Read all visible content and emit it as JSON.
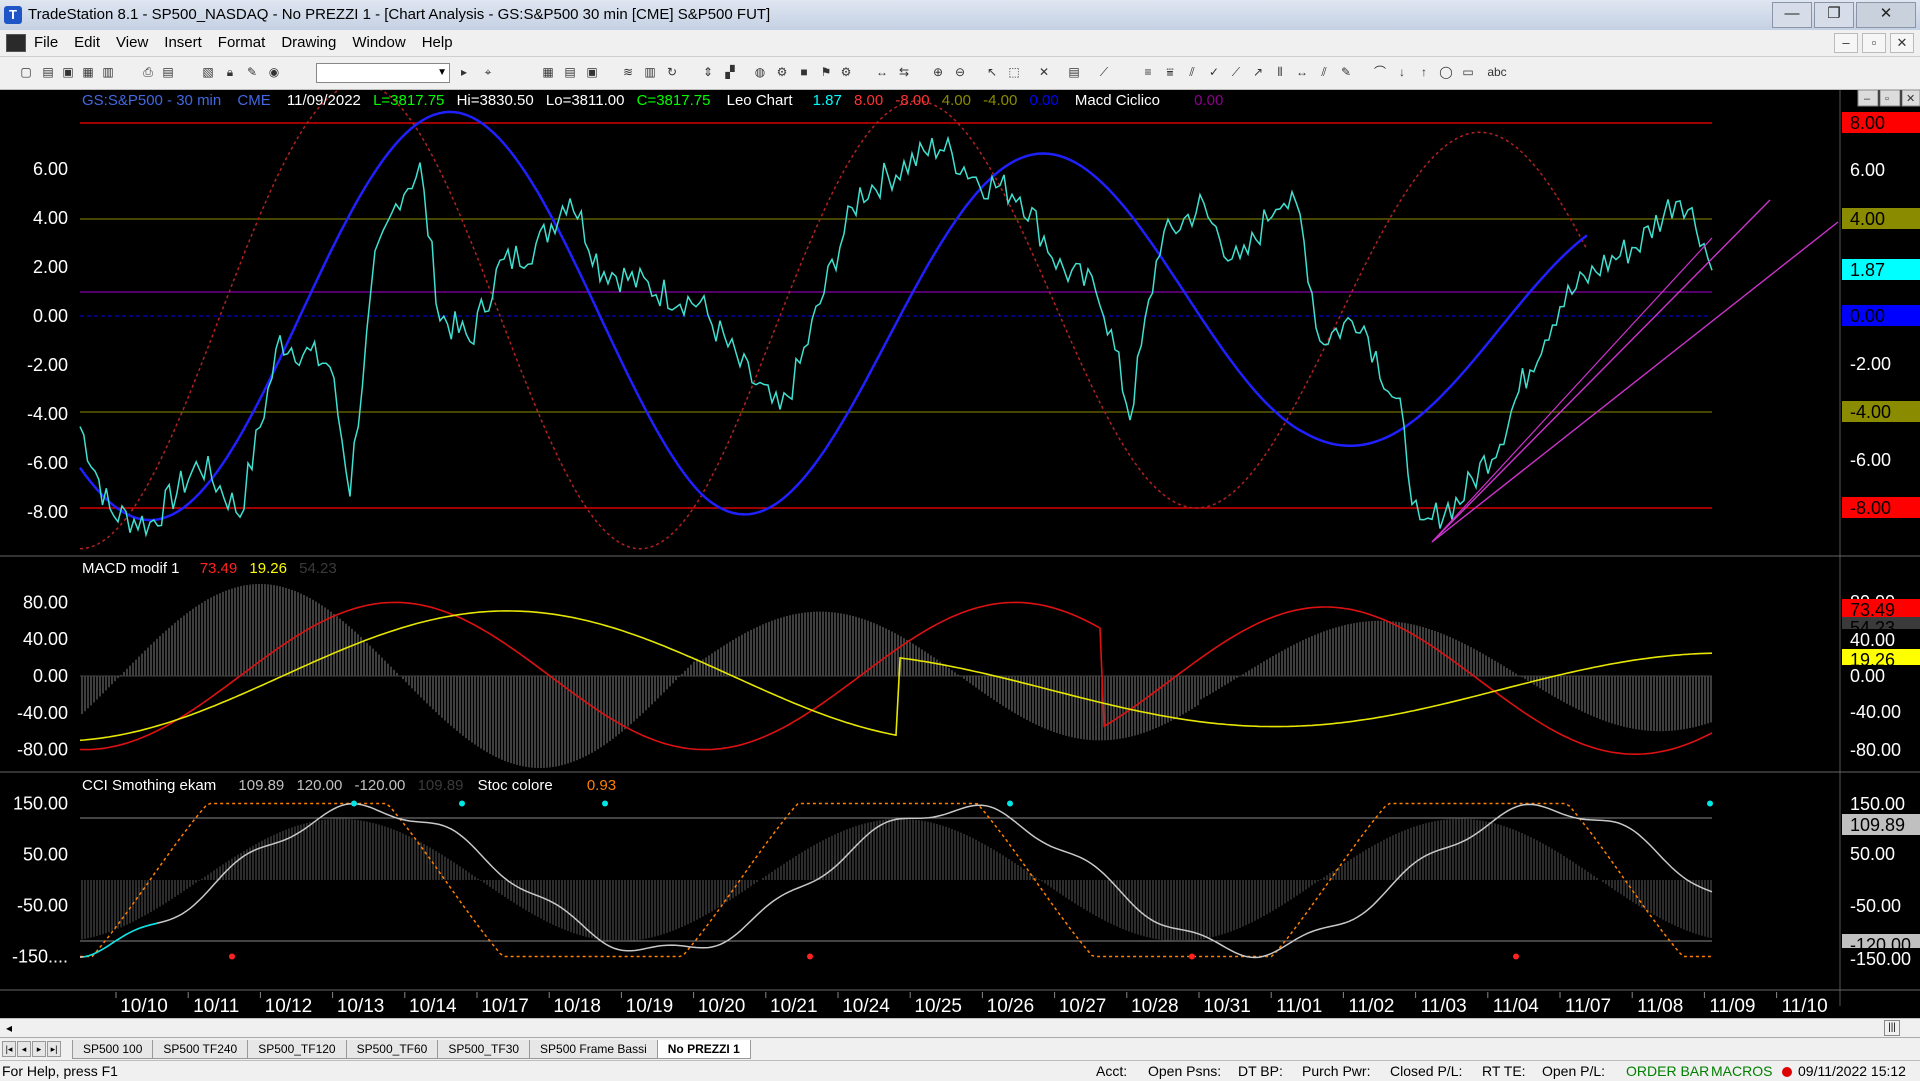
{
  "window": {
    "title": "TradeStation 8.1 - SP500_NASDAQ - No PREZZI 1 - [Chart Analysis - GS:S&P500  30 min  [CME] S&P500 FUT]",
    "app_icon": "tradestation-icon",
    "controls": {
      "minimize": "—",
      "maximize": "❐",
      "close": "✕"
    }
  },
  "menubar": {
    "items": [
      "File",
      "Edit",
      "View",
      "Insert",
      "Format",
      "Drawing",
      "Window",
      "Help"
    ],
    "mdi_controls": {
      "minimize": "–",
      "restore": "▫",
      "close": "✕"
    }
  },
  "toolbar": {
    "combo_value": "",
    "icons": [
      "new-icon",
      "open-icon",
      "save-icon",
      "save-all-icon",
      "print-preview-icon",
      "print-icon",
      "format-icon",
      "format-symbol-icon",
      "lock-icon",
      "wand-icon",
      "chart-icon",
      "crosshair-icon",
      "zoom-in-icon",
      "zoom-out-icon",
      "pointer-icon",
      "trendline-icon",
      "text-icon",
      "ellipse-icon",
      "rectangle-icon"
    ],
    "text_tool": "abc"
  },
  "chart": {
    "header": {
      "symbol": "GS:S&P500 - 30 min",
      "exchange": "CME",
      "date": "11/09/2022",
      "last": "L=3817.75",
      "high": "Hi=3830.50",
      "low": "Lo=3811.00",
      "close": "C=3817.75",
      "study1_name": "Leo Chart",
      "study1_v1": "1.87",
      "study1_v2": "8.00",
      "study1_v3": "-8.00",
      "study1_v4": "4.00",
      "study1_v5": "-4.00",
      "study1_v6": "0.00",
      "study2_name": "Macd Ciclico",
      "study2_v1": "0.00"
    },
    "panel1": {
      "y_labels": [
        "6.00",
        "4.00",
        "2.00",
        "0.00",
        "-2.00",
        "-4.00",
        "-6.00",
        "-8.00"
      ],
      "right_badges": [
        {
          "text": "8.00",
          "bg": "#ff0000",
          "fg": "#000000"
        },
        {
          "text": "6.00",
          "bg": "#000000",
          "fg": "#ffffff"
        },
        {
          "text": "4.00",
          "bg": "#8b8b00",
          "fg": "#000000"
        },
        {
          "text": "1.87",
          "bg": "#00ffff",
          "fg": "#000000"
        },
        {
          "text": "0.00",
          "bg": "#0000ff",
          "fg": "#000000"
        },
        {
          "text": "-2.00",
          "bg": "#000000",
          "fg": "#ffffff"
        },
        {
          "text": "-4.00",
          "bg": "#8b8b00",
          "fg": "#000000"
        },
        {
          "text": "-6.00",
          "bg": "#000000",
          "fg": "#ffffff"
        },
        {
          "text": "-8.00",
          "bg": "#ff0000",
          "fg": "#000000"
        }
      ]
    },
    "panel2": {
      "name": "MACD modif 1",
      "v1": "73.49",
      "v2": "19.26",
      "v3": "54.23",
      "y_labels": [
        "80.00",
        "40.00",
        "0.00",
        "-40.00",
        "-80.00"
      ],
      "right_badges": [
        {
          "text": "80.00",
          "bg": "#000000",
          "fg": "#ffffff"
        },
        {
          "text": "73.49",
          "bg": "#ff0000",
          "fg": "#000000"
        },
        {
          "text": "54.23",
          "bg": "#3a3a3a",
          "fg": "#000000"
        },
        {
          "text": "40.00",
          "bg": "#000000",
          "fg": "#ffffff"
        },
        {
          "text": "19.26",
          "bg": "#ffff00",
          "fg": "#000000"
        },
        {
          "text": "0.00",
          "bg": "#000000",
          "fg": "#ffffff"
        },
        {
          "text": "-40.00",
          "bg": "#000000",
          "fg": "#ffffff"
        },
        {
          "text": "-80.00",
          "bg": "#000000",
          "fg": "#ffffff"
        }
      ]
    },
    "panel3": {
      "name": "CCI Smothing ekam",
      "v1": "109.89",
      "v2": "120.00",
      "v3": "-120.00",
      "v4": "109.89",
      "stoc_name": "Stoc colore",
      "stoc_v": "0.93",
      "y_labels": [
        "150.00",
        "50.00",
        "-50.00",
        "-150...."
      ],
      "right_badges": [
        {
          "text": "150.00",
          "bg": "#000000",
          "fg": "#ffffff"
        },
        {
          "text": "109.89",
          "bg": "#c0c0c0",
          "fg": "#000000"
        },
        {
          "text": "50.00",
          "bg": "#000000",
          "fg": "#ffffff"
        },
        {
          "text": "-50.00",
          "bg": "#000000",
          "fg": "#ffffff"
        },
        {
          "text": "-120.00",
          "bg": "#c0c0c0",
          "fg": "#000000"
        },
        {
          "text": "-150.00",
          "bg": "#000000",
          "fg": "#ffffff"
        }
      ]
    },
    "x_labels": [
      "10/10",
      "10/11",
      "10/12",
      "10/13",
      "10/14",
      "10/17",
      "10/18",
      "10/19",
      "10/20",
      "10/21",
      "10/24",
      "10/25",
      "10/26",
      "10/27",
      "10/28",
      "10/31",
      "11/01",
      "11/02",
      "11/03",
      "11/04",
      "11/07",
      "11/08",
      "11/09",
      "11/10"
    ]
  },
  "tabs": {
    "items": [
      "SP500 100",
      "SP500 TF240",
      "SP500_TF120",
      "SP500_TF60",
      "SP500_TF30",
      "SP500 Frame Bassi",
      "No PREZZI 1"
    ],
    "active_index": 6
  },
  "statusbar": {
    "help": "For Help, press F1",
    "acct": "Acct:",
    "open_psns": "Open Psns:",
    "dt_bp": "DT BP:",
    "purch_pwr": "Purch Pwr:",
    "closed_pl": "Closed P/L:",
    "rt_te": "RT TE:",
    "open_pl": "Open P/L:",
    "order_bar": "ORDER BAR",
    "macros": "MACROS",
    "datetime": "09/11/2022 15:12"
  }
}
